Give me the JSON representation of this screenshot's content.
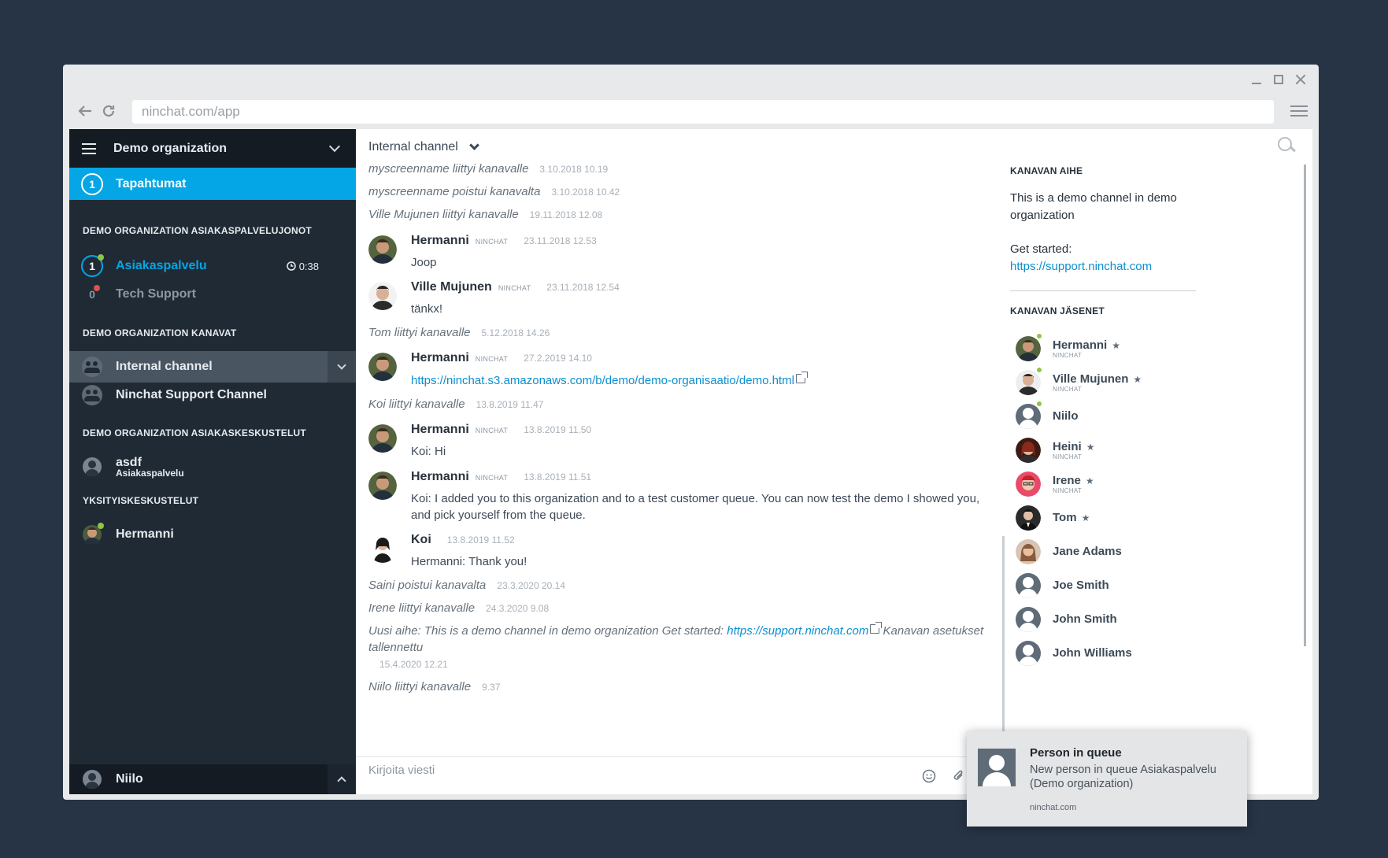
{
  "browser": {
    "url": "ninchat.com/app"
  },
  "sidebar": {
    "org_name": "Demo organization",
    "events": {
      "count": "1",
      "label": "Tapahtumat"
    },
    "queues_title": "DEMO ORGANIZATION ASIAKASPALVELUJONOT",
    "queues": [
      {
        "count": "1",
        "name": "Asiakaspalvelu",
        "wait": "0:38"
      },
      {
        "count": "0",
        "name": "Tech Support"
      }
    ],
    "channels_title": "DEMO ORGANIZATION KANAVAT",
    "channels": [
      {
        "name": "Internal channel"
      },
      {
        "name": "Ninchat Support Channel"
      }
    ],
    "customer_title": "DEMO ORGANIZATION ASIAKASKESKUSTELUT",
    "customer_chats": [
      {
        "name": "asdf",
        "sub": "Asiakaspalvelu"
      }
    ],
    "private_title": "YKSITYISKESKUSTELUT",
    "private_chats": [
      {
        "name": "Hermanni"
      }
    ],
    "current_user": "Niilo"
  },
  "chat": {
    "channel_name": "Internal channel",
    "composer_placeholder": "Kirjoita viesti",
    "messages": [
      {
        "type": "system",
        "text": "myscreenname liittyi kanavalle",
        "time": "3.10.2018 10.19"
      },
      {
        "type": "system",
        "text": "myscreenname poistui kanavalta",
        "time": "3.10.2018 10.42"
      },
      {
        "type": "system",
        "text": "Ville Mujunen liittyi kanavalle",
        "time": "19.11.2018 12.08"
      },
      {
        "type": "user",
        "name": "Hermanni",
        "tag": "NINCHAT",
        "time": "23.11.2018 12.53",
        "text": "Joop"
      },
      {
        "type": "user",
        "name": "Ville Mujunen",
        "tag": "NINCHAT",
        "time": "23.11.2018 12.54",
        "text": "tänkx!"
      },
      {
        "type": "system",
        "text": "Tom liittyi kanavalle",
        "time": "5.12.2018 14.26"
      },
      {
        "type": "user",
        "name": "Hermanni",
        "tag": "NINCHAT",
        "time": "27.2.2019 14.10",
        "text": "https://ninchat.s3.amazonaws.com/b/demo/demo-organisaatio/demo.html"
      },
      {
        "type": "system",
        "text": "Koi liittyi kanavalle",
        "time": "13.8.2019 11.47"
      },
      {
        "type": "user",
        "name": "Hermanni",
        "tag": "NINCHAT",
        "time": "13.8.2019 11.50",
        "text": "Koi: Hi"
      },
      {
        "type": "user",
        "name": "Hermanni",
        "tag": "NINCHAT",
        "time": "13.8.2019 11.51",
        "text": "Koi: I added you to this organization and to a test customer queue. You can now test the demo I showed you, and pick yourself from the queue."
      },
      {
        "type": "user",
        "name": "Koi",
        "time": "13.8.2019 11.52",
        "text": "Hermanni: Thank you!"
      },
      {
        "type": "system",
        "text": "Saini poistui kanavalta",
        "time": "23.3.2020 20.14"
      },
      {
        "type": "system",
        "text": "Irene liittyi kanavalle",
        "time": "24.3.2020 9.08"
      },
      {
        "type": "system",
        "text_pre": "Uusi aihe: This is a demo channel in demo organization Get started: ",
        "link": "https://support.ninchat.com",
        "text_post": " Kanavan asetukset tallennettu",
        "time": "15.4.2020 12.21"
      },
      {
        "type": "system",
        "text": "Niilo liittyi kanavalle",
        "time": "9.37"
      }
    ]
  },
  "info": {
    "topic_title": "KANAVAN AIHE",
    "topic_text": "This is a demo channel in demo organization",
    "started_label": "Get started:",
    "started_link": "https://support.ninchat.com",
    "members_title": "KANAVAN JÄSENET",
    "members": [
      {
        "name": "Hermanni",
        "tag": "NINCHAT",
        "star": "★"
      },
      {
        "name": "Ville Mujunen",
        "tag": "NINCHAT",
        "star": "★"
      },
      {
        "name": "Niilo"
      },
      {
        "name": "Heini",
        "tag": "NINCHAT",
        "star": "★"
      },
      {
        "name": "Irene",
        "tag": "NINCHAT",
        "star": "★"
      },
      {
        "name": "Tom",
        "star": "★"
      },
      {
        "name": "Jane Adams"
      },
      {
        "name": "Joe Smith"
      },
      {
        "name": "John Smith"
      },
      {
        "name": "John Williams"
      }
    ]
  },
  "notification": {
    "title": "Person in queue",
    "body": "New person in queue Asiakaspalvelu (Demo organization)",
    "source": "ninchat.com"
  },
  "colors": {
    "accent": "#04a6e5",
    "sidebar_bg": "#202a35",
    "page_bg": "#263446",
    "online": "#8dc63f",
    "busy": "#d9534f"
  }
}
